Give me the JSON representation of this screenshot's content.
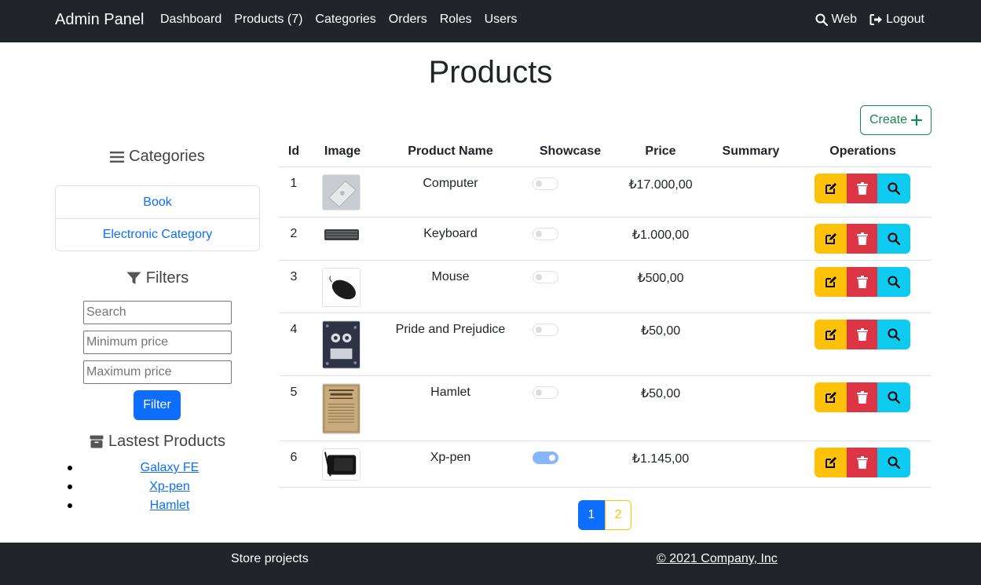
{
  "navbar": {
    "brand": "Admin Panel",
    "links": [
      "Dashboard",
      "Products (7)",
      "Categories",
      "Orders",
      "Roles",
      "Users"
    ],
    "web_label": "Web",
    "logout_label": "Logout"
  },
  "page": {
    "title": "Products",
    "create_label": "Create"
  },
  "sidebar": {
    "categories_title": "Categories",
    "categories": [
      "Book",
      "Electronic Category"
    ],
    "filters_title": "Filters",
    "search_placeholder": "Search",
    "min_price_placeholder": "Minimum price",
    "max_price_placeholder": "Maximum price",
    "filter_label": "Filter",
    "latest_title": "Lastest Products",
    "latest": [
      "Galaxy FE",
      "Xp-pen",
      "Hamlet"
    ]
  },
  "table": {
    "headers": [
      "Id",
      "Image",
      "Product Name",
      "Showcase",
      "Price",
      "Summary",
      "Operations"
    ],
    "rows": [
      {
        "id": "1",
        "name": "Computer",
        "price": "₺17.000,00",
        "showcase": false,
        "summary": ""
      },
      {
        "id": "2",
        "name": "Keyboard",
        "price": "₺1.000,00",
        "showcase": false,
        "summary": ""
      },
      {
        "id": "3",
        "name": "Mouse",
        "price": "₺500,00",
        "showcase": false,
        "summary": ""
      },
      {
        "id": "4",
        "name": "Pride and Prejudice",
        "price": "₺50,00",
        "showcase": false,
        "summary": ""
      },
      {
        "id": "5",
        "name": "Hamlet",
        "price": "₺50,00",
        "showcase": false,
        "summary": ""
      },
      {
        "id": "6",
        "name": "Xp-pen",
        "price": "₺1.145,00",
        "showcase": true,
        "summary": ""
      }
    ]
  },
  "pagination": {
    "pages": [
      "1",
      "2"
    ],
    "current": "1"
  },
  "footer": {
    "left": "Store projects",
    "right": "© 2021 Company, Inc"
  },
  "colors": {
    "navbar": "#212529",
    "primary": "#0d6efd",
    "success": "#198754",
    "warning": "#ffc107",
    "danger": "#dc3545",
    "info": "#0dcaf0"
  }
}
